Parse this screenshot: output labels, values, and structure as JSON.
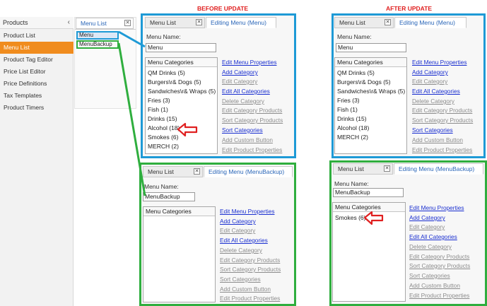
{
  "captions": {
    "before": "BEFORE UPDATE",
    "after": "AFTER UPDATE"
  },
  "products": {
    "title": "Products",
    "chevron": "‹",
    "items": [
      {
        "label": "Product List",
        "active": false
      },
      {
        "label": "Menu List",
        "active": true
      },
      {
        "label": "Product Tag Editor",
        "active": false
      },
      {
        "label": "Price List Editor",
        "active": false
      },
      {
        "label": "Price Definitions",
        "active": false
      },
      {
        "label": "Tax Templates",
        "active": false
      },
      {
        "label": "Product Timers",
        "active": false
      }
    ]
  },
  "menu_list": {
    "tab_label": "Menu List",
    "close": "✕",
    "items": [
      "Menu",
      "MenuBackup"
    ]
  },
  "panels": {
    "before_menu": {
      "list_tab": "Menu List",
      "edit_tab": "Editing Menu (Menu)",
      "close": "✕",
      "name_label": "Menu Name:",
      "name_value": "Menu",
      "cat_header": "Menu Categories",
      "categories": [
        "QM Drinks (5)",
        "Burgers\\r& Dogs (5)",
        "Sandwiches\\r& Wraps (5)",
        "Fries (3)",
        "Fish (1)",
        "Drinks (15)",
        "Alcohol (18)",
        "Smokes (6)",
        "MERCH (2)"
      ]
    },
    "after_menu": {
      "list_tab": "Menu List",
      "edit_tab": "Editing Menu (Menu)",
      "close": "✕",
      "name_label": "Menu Name:",
      "name_value": "Menu",
      "cat_header": "Menu Categories",
      "categories": [
        "QM Drinks (5)",
        "Burgers\\r& Dogs (5)",
        "Sandwiches\\r& Wraps (5)",
        "Fries (3)",
        "Fish (1)",
        "Drinks (15)",
        "Alcohol (18)",
        "MERCH (2)"
      ]
    },
    "before_backup": {
      "list_tab": "Menu List",
      "edit_tab": "Editing Menu (MenuBackup)",
      "close": "✕",
      "name_label": "Menu Name:",
      "name_value": "MenuBackup",
      "cat_header": "Menu Categories",
      "categories": []
    },
    "after_backup": {
      "list_tab": "Menu List",
      "edit_tab": "Editing Menu (MenuBackup)",
      "close": "✕",
      "name_label": "Menu Name:",
      "name_value": "MenuBackup",
      "cat_header": "Menu Categories",
      "categories": [
        "Smokes (6)"
      ]
    }
  },
  "actions_with_selection": [
    {
      "label": "Edit Menu Properties",
      "enabled": true
    },
    {
      "label": "Add Category",
      "enabled": true
    },
    {
      "label": "Edit Category",
      "enabled": false
    },
    {
      "label": "Edit All Categories",
      "enabled": true
    },
    {
      "label": "Delete Category",
      "enabled": false
    },
    {
      "label": "Edit Category Products",
      "enabled": false
    },
    {
      "label": "Sort Category Products",
      "enabled": false
    },
    {
      "label": "Sort Categories",
      "enabled": true
    },
    {
      "label": "Add Custom Button",
      "enabled": false
    },
    {
      "label": "Edit Product Properties",
      "enabled": false
    }
  ],
  "actions_empty": [
    {
      "label": "Edit Menu Properties",
      "enabled": true
    },
    {
      "label": "Add Category",
      "enabled": true
    },
    {
      "label": "Edit Category",
      "enabled": false
    },
    {
      "label": "Edit All Categories",
      "enabled": true
    },
    {
      "label": "Delete Category",
      "enabled": false
    },
    {
      "label": "Edit Category Products",
      "enabled": false
    },
    {
      "label": "Sort Category Products",
      "enabled": false
    },
    {
      "label": "Sort Categories",
      "enabled": false
    },
    {
      "label": "Add Custom Button",
      "enabled": false
    },
    {
      "label": "Edit Product Properties",
      "enabled": false
    }
  ],
  "colors": {
    "blue_frame": "#1e9ad6",
    "green_frame": "#2fae3e",
    "red_arrow": "#e02020",
    "active_nav": "#f08c1e",
    "link": "#1a2fd0",
    "disabled_link": "#8c8c8c"
  }
}
